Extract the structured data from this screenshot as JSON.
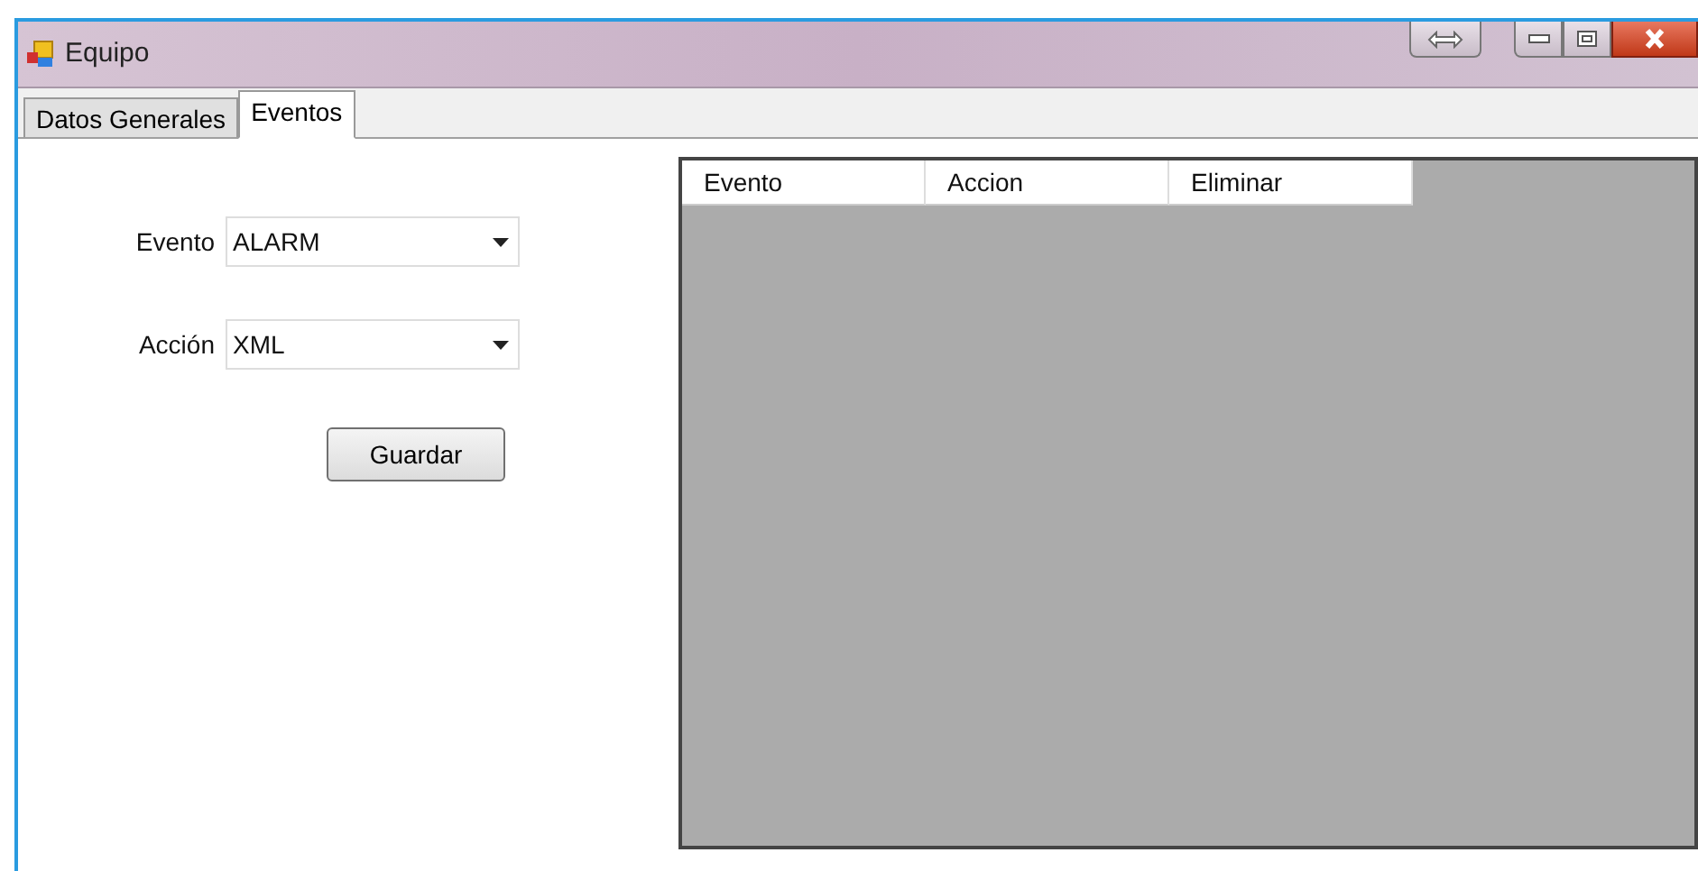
{
  "window": {
    "title": "Equipo"
  },
  "tabs": [
    {
      "label": "Datos Generales",
      "selected": false
    },
    {
      "label": "Eventos",
      "selected": true
    }
  ],
  "form": {
    "fields": [
      {
        "label": "Evento",
        "value": "ALARM"
      },
      {
        "label": "Acción",
        "value": "XML"
      }
    ],
    "save_button": "Guardar"
  },
  "table": {
    "columns": [
      "Evento",
      "Accion",
      "Eliminar"
    ]
  }
}
